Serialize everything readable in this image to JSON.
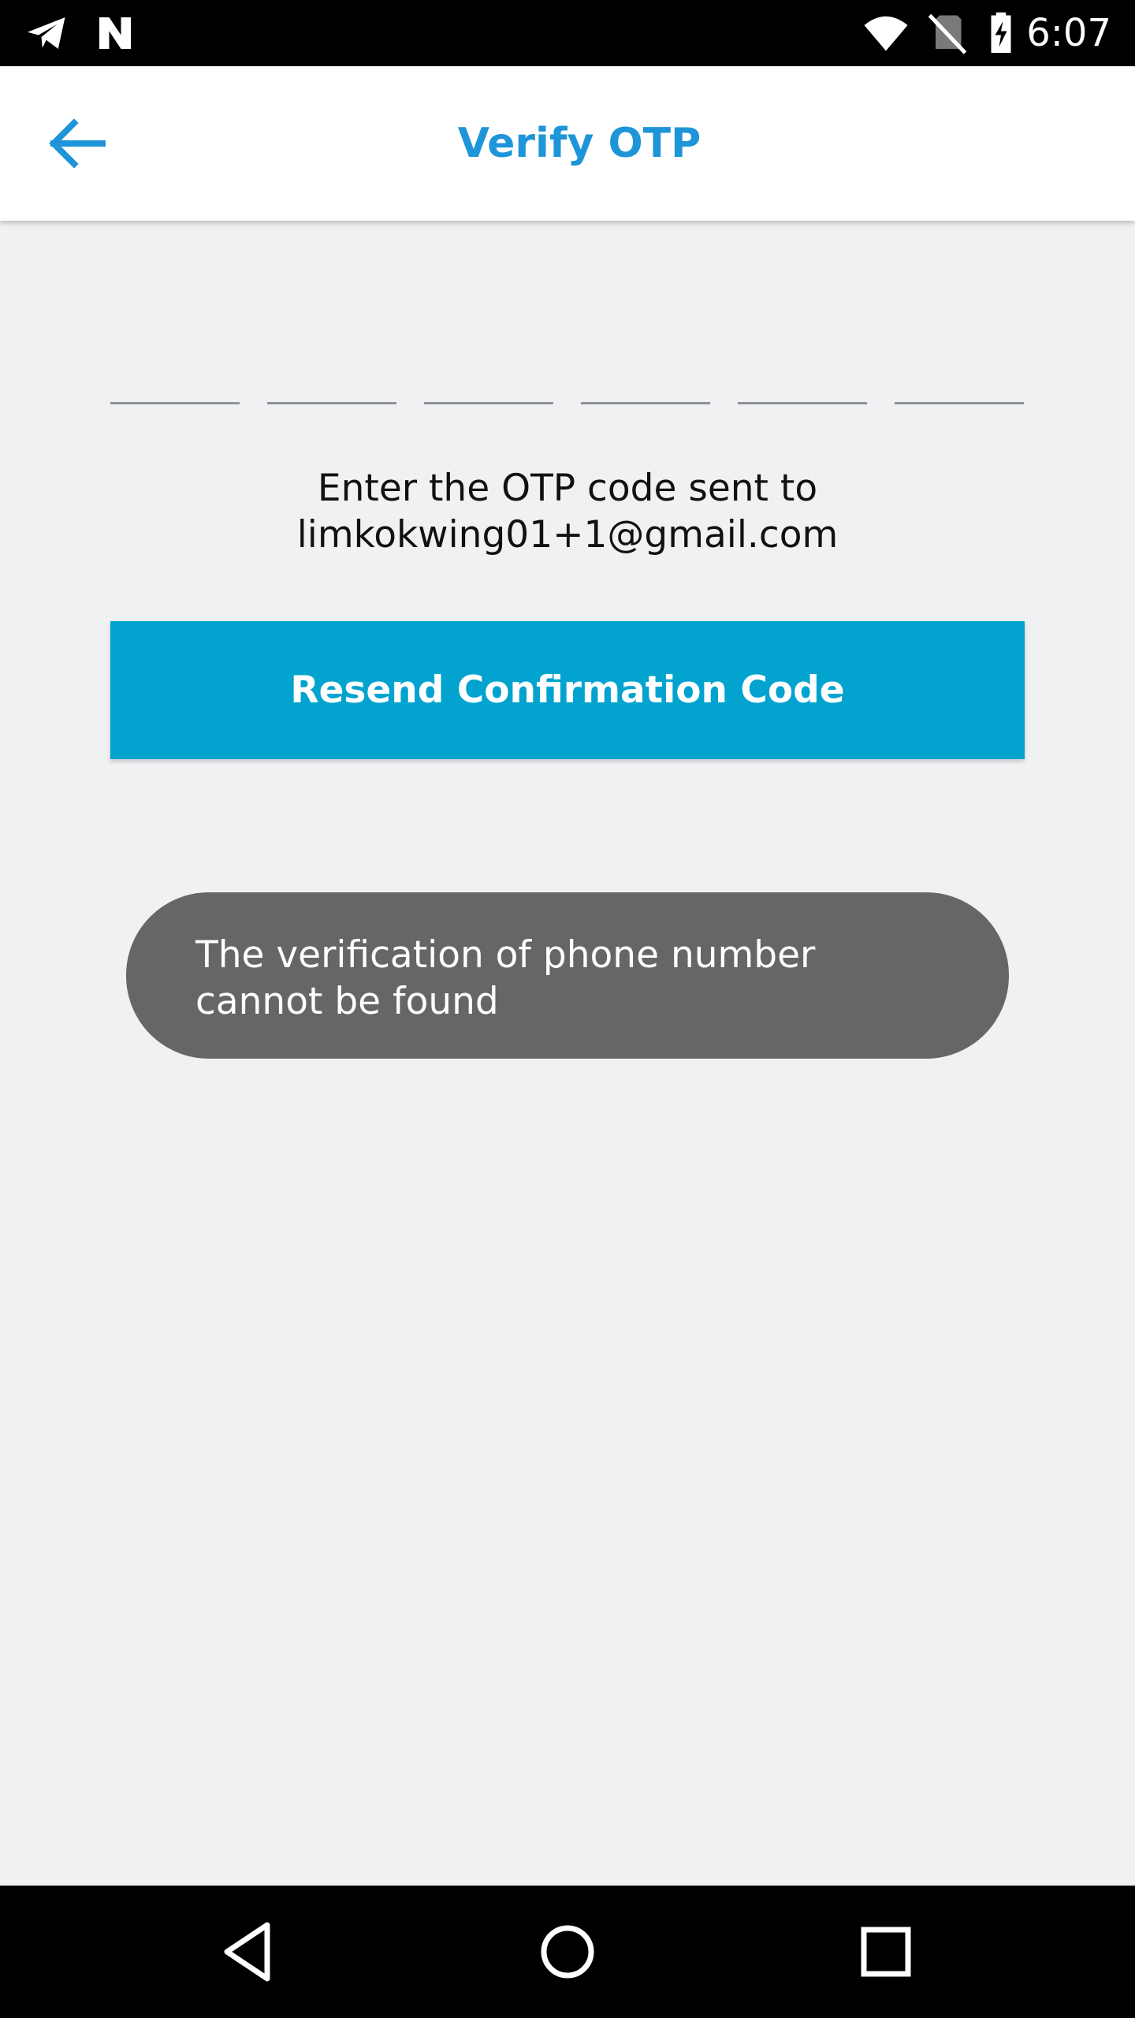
{
  "status_bar": {
    "time": "6:07",
    "icons": [
      "telegram-icon",
      "n-notification-icon",
      "wifi-icon",
      "no-sim-icon",
      "battery-charging-icon"
    ]
  },
  "app_bar": {
    "title": "Verify OTP",
    "back_icon": "arrow-left-icon"
  },
  "otp": {
    "digits": [
      "",
      "",
      "",
      "",
      "",
      ""
    ]
  },
  "instruction": {
    "line1": "Enter the OTP code sent to",
    "line2": "limkokwing01+1@gmail.com"
  },
  "resend_button": {
    "label": "Resend Confirmation Code"
  },
  "toast": {
    "line1": "The verification of phone number",
    "line2": "cannot be found"
  },
  "nav_bar": {
    "icons": [
      "back-triangle-icon",
      "home-circle-icon",
      "recents-square-icon"
    ]
  },
  "colors": {
    "accent": "#1e95d8",
    "button": "#03a3cf",
    "background": "#f0f1f3",
    "toast": "#666666"
  }
}
